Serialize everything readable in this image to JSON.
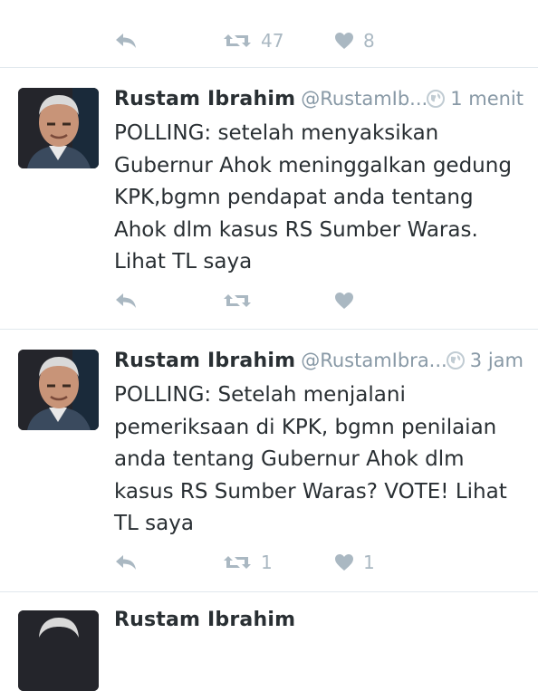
{
  "colors": {
    "action_gray": "#aab8c2",
    "meta_gray": "#8899a6",
    "text": "#292f33",
    "divider": "#e1e8ed"
  },
  "top_actions": {
    "retweet_count": "47",
    "like_count": "8"
  },
  "tweets": [
    {
      "name": "Rustam Ibrahim",
      "handle": "@RustamIb...",
      "time": "1 menit",
      "text": "POLLING: setelah menyaksikan Gubernur Ahok meninggalkan gedung KPK,bgmn pendapat anda tentang Ahok dlm kasus RS Sumber Waras. Lihat TL saya",
      "retweet_count": "",
      "like_count": ""
    },
    {
      "name": "Rustam Ibrahim",
      "handle": "@RustamIbra...",
      "time": "3 jam",
      "text": "POLLING: Setelah menjalani pemeriksaan di KPK, bgmn penilaian anda tentang Gubernur Ahok dlm kasus RS Sumber Waras? VOTE! Lihat TL saya",
      "retweet_count": "1",
      "like_count": "1"
    }
  ],
  "bottom_partial": {
    "name": "Rustam Ibrahim"
  },
  "icons": [
    "reply-icon",
    "retweet-icon",
    "like-icon",
    "globe-icon"
  ]
}
